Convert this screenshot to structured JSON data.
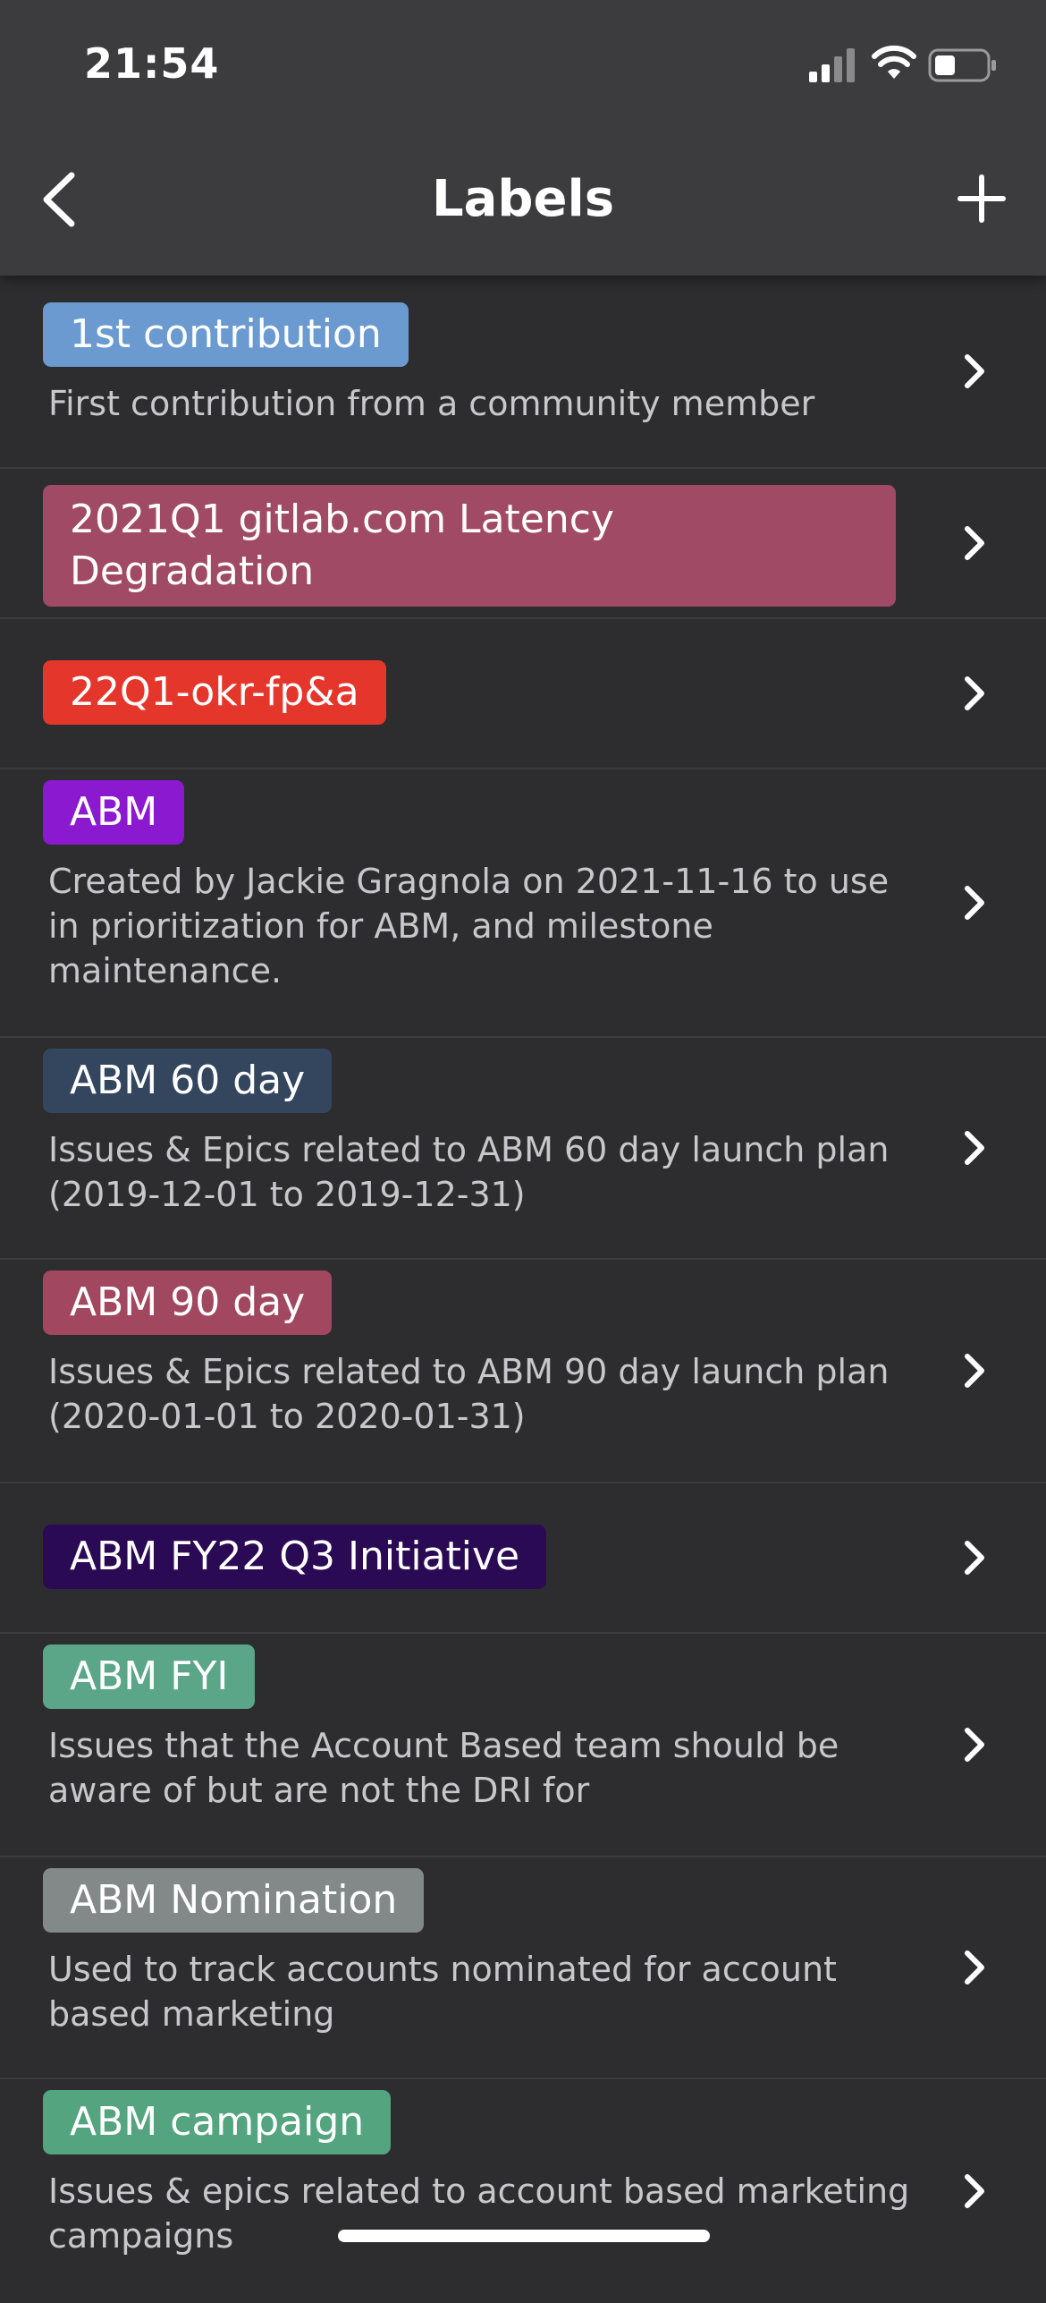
{
  "status_bar": {
    "time": "21:54",
    "signal_icon": "cellular-signal-icon",
    "wifi_icon": "wifi-icon",
    "battery_icon": "battery-icon"
  },
  "nav": {
    "title": "Labels",
    "back_icon": "chevron-left-icon",
    "add_icon": "plus-icon"
  },
  "labels": [
    {
      "name": "1st contribution",
      "color": "#6a9ad0",
      "description": "First contribution from a community member"
    },
    {
      "name": "2021Q1 gitlab.com Latency Degradation",
      "color": "#a14a65",
      "description": ""
    },
    {
      "name": "22Q1-okr-fp&a",
      "color": "#e5362b",
      "description": ""
    },
    {
      "name": "ABM",
      "color": "#8b19d0",
      "description": "Created by Jackie Gragnola on 2021-11-16 to use in prioritization for ABM, and milestone maintenance."
    },
    {
      "name": "ABM 60 day",
      "color": "#34465e",
      "description": "Issues & Epics related to ABM 60 day launch plan (2019-12-01 to 2019-12-31)"
    },
    {
      "name": "ABM 90 day",
      "color": "#a1475f",
      "description": "Issues & Epics related to ABM 90 day launch plan (2020-01-01 to 2020-01-31)"
    },
    {
      "name": "ABM FY22 Q3 Initiative",
      "color": "#2b0a55",
      "description": ""
    },
    {
      "name": "ABM FYI",
      "color": "#5ba688",
      "description": "Issues that the Account Based team should be aware of but are not the DRI for"
    },
    {
      "name": "ABM Nomination",
      "color": "#838889",
      "description": "Used to track accounts nominated for account based marketing"
    },
    {
      "name": "ABM campaign",
      "color": "#53a47f",
      "description": "Issues & epics related to account based marketing campaigns"
    }
  ],
  "colors": {
    "background": "#2d2d2f",
    "header": "#3c3c3e",
    "separator": "#3c3c3e",
    "description_text": "#c8c8cc"
  }
}
